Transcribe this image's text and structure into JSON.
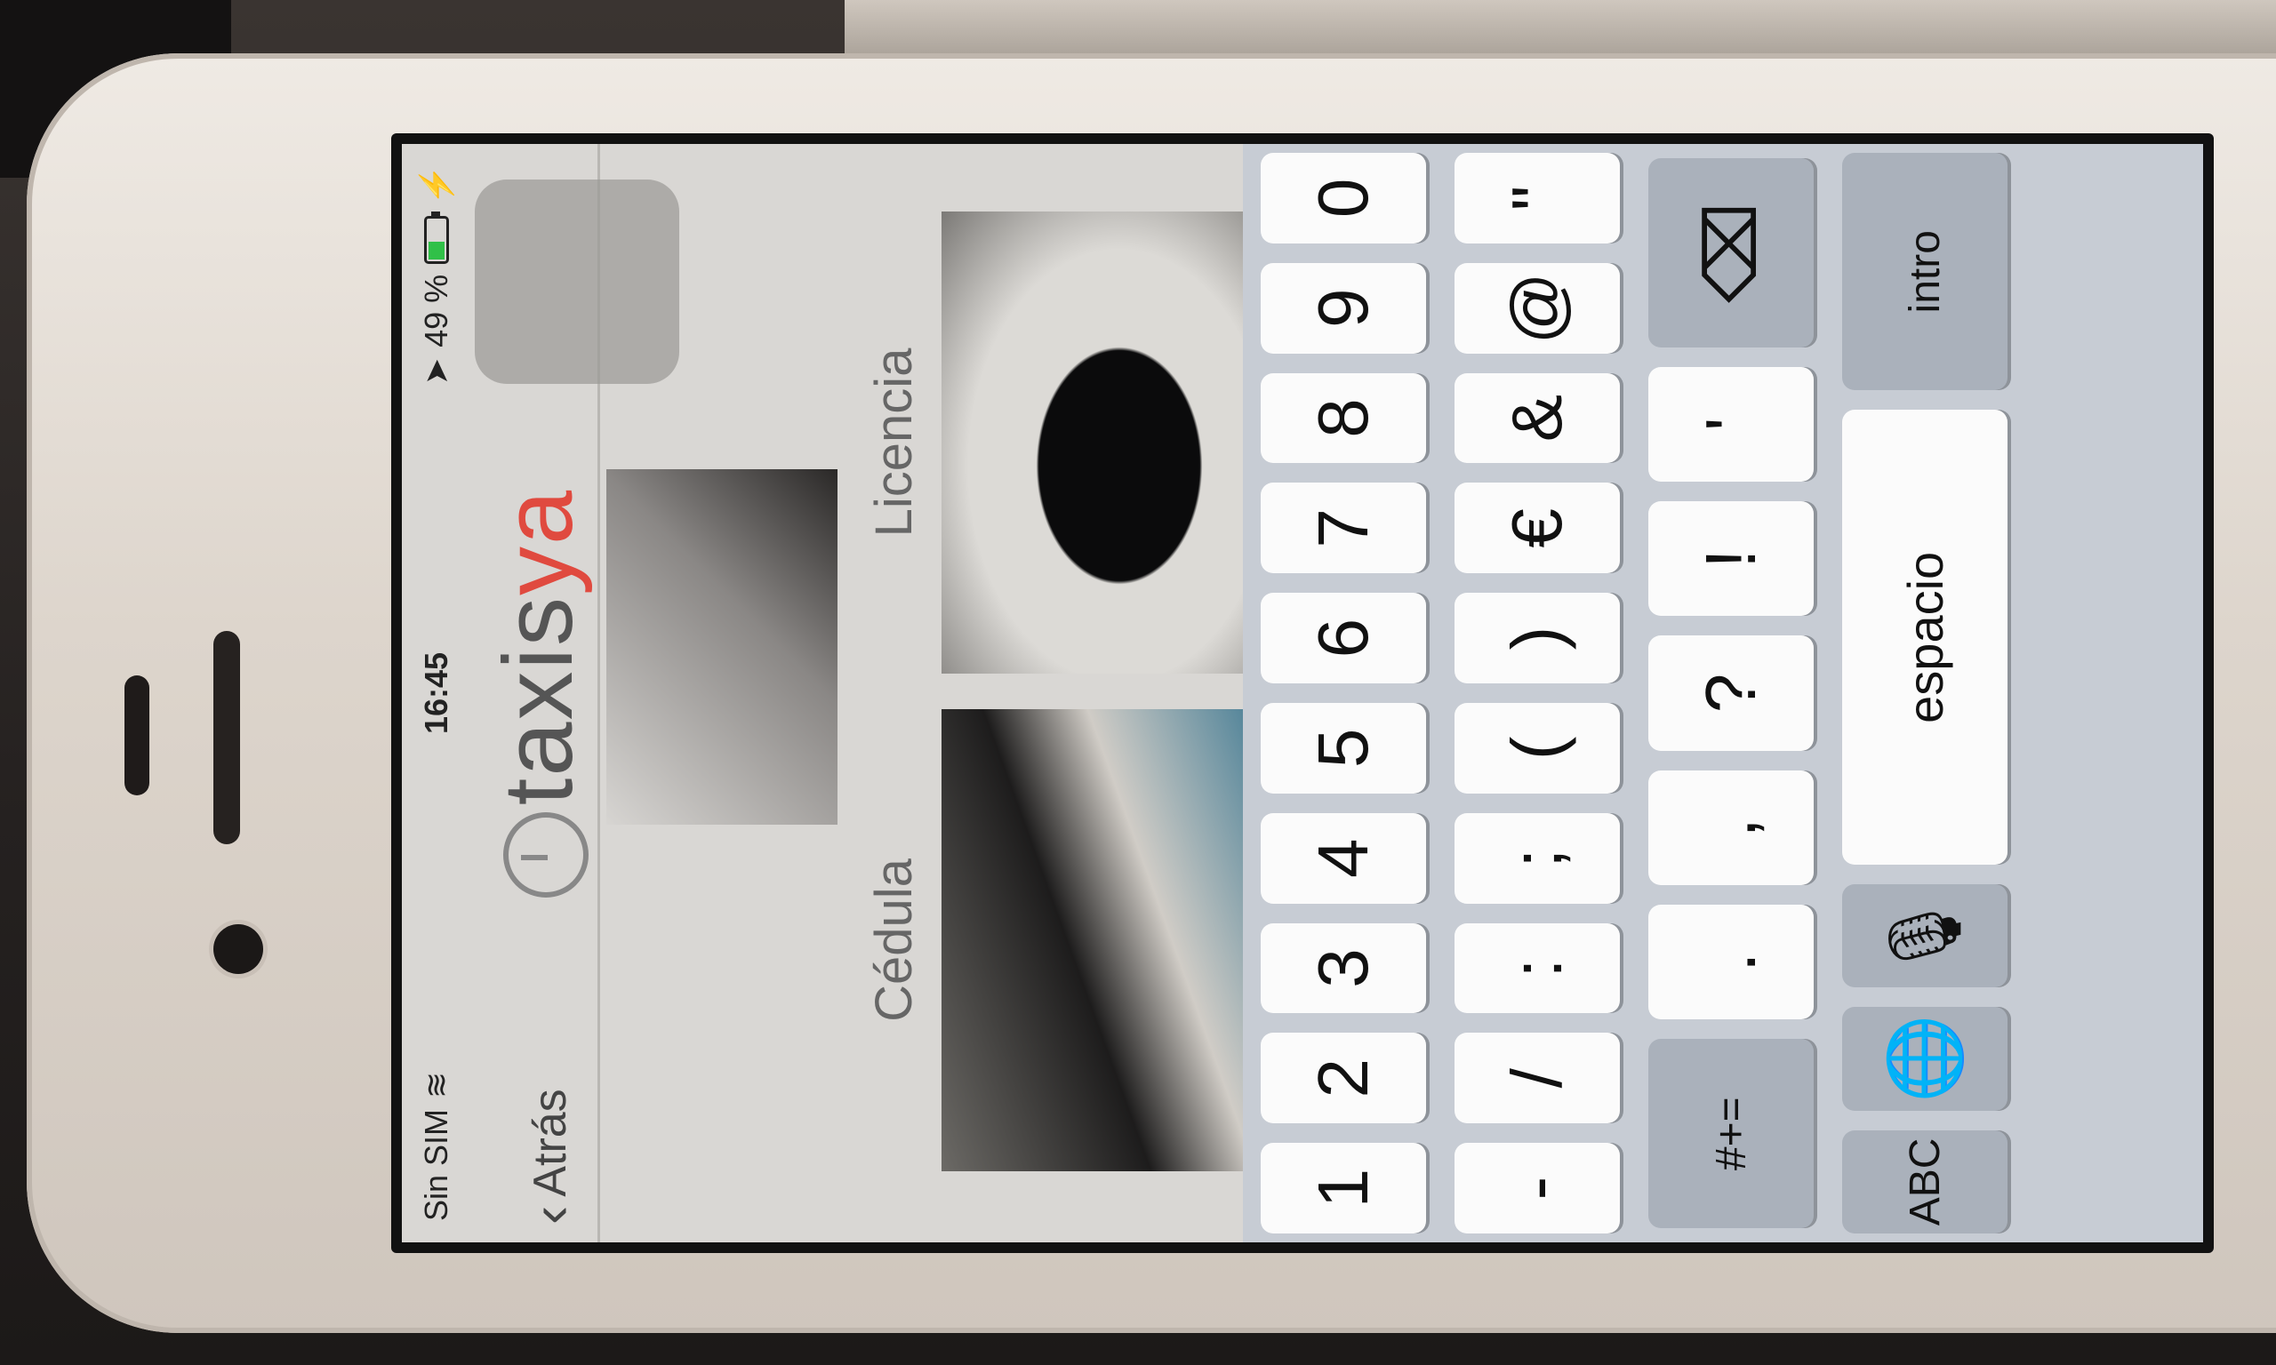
{
  "status_bar": {
    "carrier": "Sin SIM",
    "time": "16:45",
    "battery_percent": "49 %",
    "battery_level": 0.49
  },
  "nav": {
    "back_label": "Atrás",
    "logo_text_main": "taxis",
    "logo_text_accent": "ya"
  },
  "documents": [
    {
      "label": "Cédula"
    },
    {
      "label": "Licencia"
    }
  ],
  "keyboard": {
    "row1": [
      "1",
      "2",
      "3",
      "4",
      "5",
      "6",
      "7",
      "8",
      "9",
      "0"
    ],
    "row2": [
      "-",
      "/",
      ":",
      ";",
      "(",
      ")",
      "€",
      "&",
      "@",
      "\""
    ],
    "row3": [
      ".",
      ",",
      "?",
      "!",
      "'"
    ],
    "row3_left": "#+=",
    "bottom": {
      "abc": "ABC",
      "space": "espacio",
      "return": "intro"
    }
  },
  "colors": {
    "accent": "#e04a3f",
    "battery_fill": "#30c048"
  }
}
